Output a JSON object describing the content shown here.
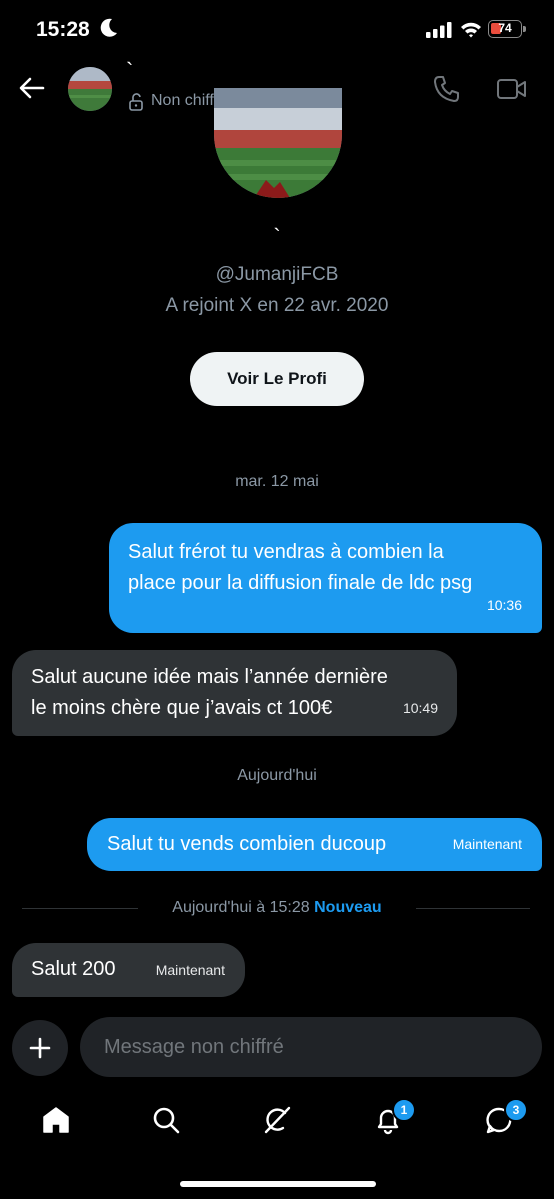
{
  "status_bar": {
    "time": "15:28",
    "battery": "74"
  },
  "header": {
    "name": "`",
    "encryption": "Non chiffrés"
  },
  "profile": {
    "name": "`",
    "handle": "@JumanjiFCB",
    "joined": "A rejoint X en 22 avr. 2020",
    "button": "Voir Le Profi"
  },
  "messages": [
    {
      "date": "mar. 12 mai"
    },
    {
      "dir": "out",
      "line1": "Salut frérot tu vendras à combien la",
      "line2": "place pour la diffusion finale de ldc psg",
      "time": "10:36"
    },
    {
      "dir": "in",
      "line1": "Salut aucune idée mais l’année dernière",
      "line2": "le moins chère que j’avais ct 100€",
      "time": "10:49"
    },
    {
      "date": "Aujourd'hui"
    },
    {
      "dir": "out",
      "text": "Salut tu vends combien ducoup",
      "time": "Maintenant"
    },
    {
      "new_divider": "Aujourd'hui à 15:28",
      "new_label": "Nouveau"
    },
    {
      "dir": "in",
      "text": "Salut 200",
      "time": "Maintenant"
    }
  ],
  "composer": {
    "placeholder": "Message non chiffré"
  },
  "tabbar": {
    "notifications_badge": "1",
    "messages_badge": "3"
  },
  "colors": {
    "accent": "#1d9bf0",
    "incoming": "#2f3336",
    "background": "#000000"
  }
}
